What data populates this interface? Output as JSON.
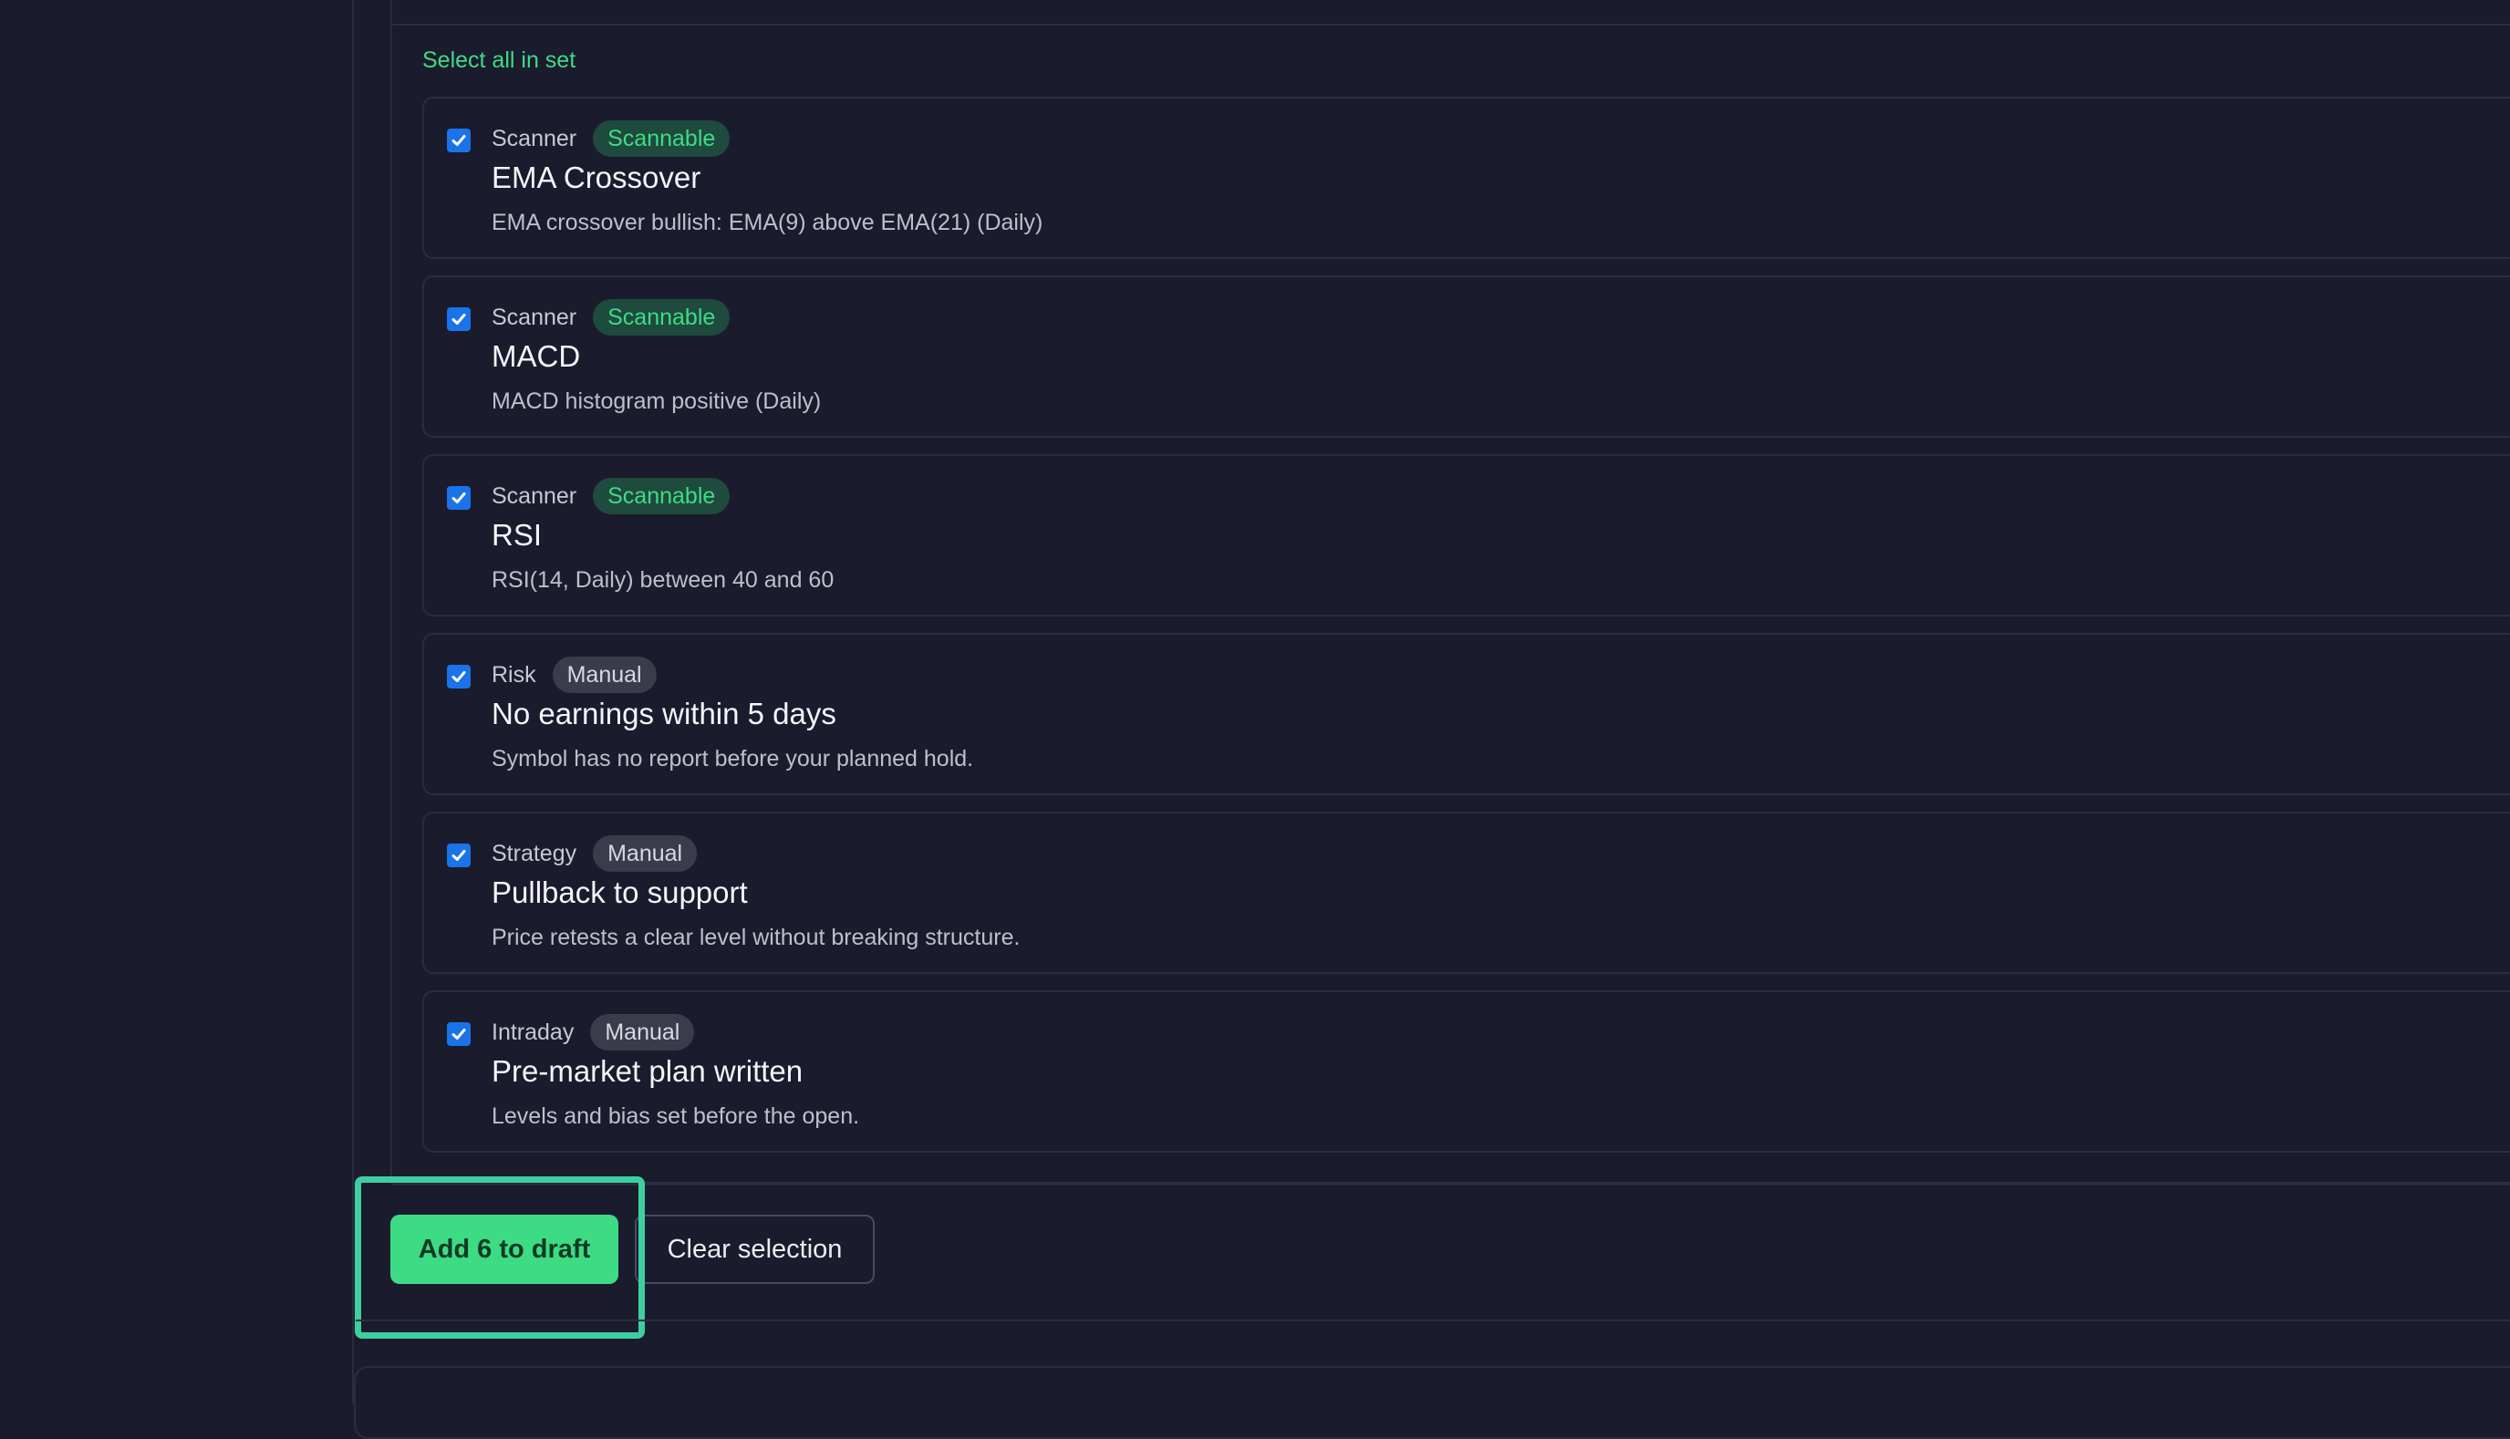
{
  "select_all_label": "Select all in set",
  "items": [
    {
      "category": "Scanner",
      "badge": "Scannable",
      "title": "EMA Crossover",
      "desc": "EMA crossover bullish: EMA(9) above EMA(21) (Daily)",
      "checked": true
    },
    {
      "category": "Scanner",
      "badge": "Scannable",
      "title": "MACD",
      "desc": "MACD histogram positive (Daily)",
      "checked": true
    },
    {
      "category": "Scanner",
      "badge": "Scannable",
      "title": "RSI",
      "desc": "RSI(14, Daily) between 40 and 60",
      "checked": true
    },
    {
      "category": "Risk",
      "badge": "Manual",
      "title": "No earnings within 5 days",
      "desc": "Symbol has no report before your planned hold.",
      "checked": true
    },
    {
      "category": "Strategy",
      "badge": "Manual",
      "title": "Pullback to support",
      "desc": "Price retests a clear level without breaking structure.",
      "checked": true
    },
    {
      "category": "Intraday",
      "badge": "Manual",
      "title": "Pre-market plan written",
      "desc": "Levels and bias set before the open.",
      "checked": true
    }
  ],
  "actions": {
    "add_label": "Add 6 to draft",
    "clear_label": "Clear selection"
  },
  "colors": {
    "background": "#1b1b2e",
    "accent": "#3ddc84",
    "checkbox": "#1a73e8",
    "highlight": "#3ecfa0"
  }
}
